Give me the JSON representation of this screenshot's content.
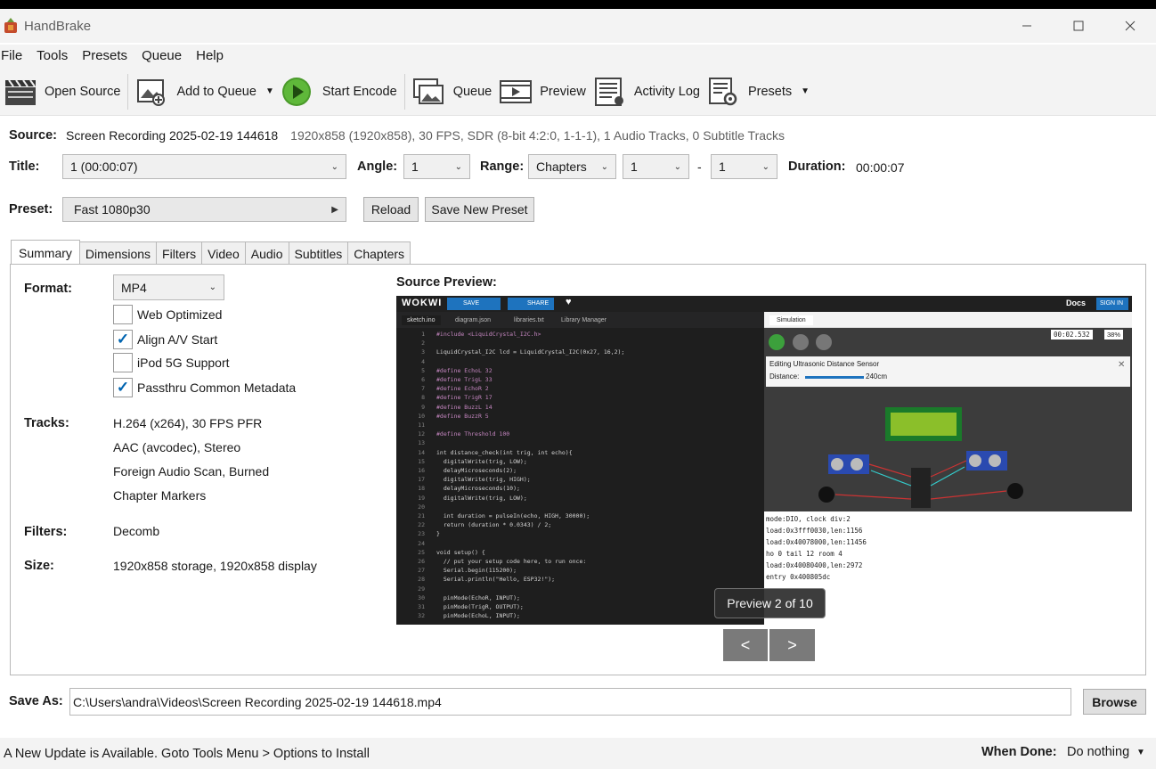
{
  "window": {
    "title": "HandBrake"
  },
  "menu": [
    "File",
    "Tools",
    "Presets",
    "Queue",
    "Help"
  ],
  "toolbar": {
    "open_source": "Open Source",
    "add_to_queue": "Add to Queue",
    "start_encode": "Start Encode",
    "queue": "Queue",
    "preview": "Preview",
    "activity_log": "Activity Log",
    "presets": "Presets"
  },
  "source": {
    "label": "Source:",
    "name": "Screen Recording 2025-02-19 144618",
    "info": "1920x858 (1920x858), 30 FPS, SDR (8-bit 4:2:0, 1-1-1), 1 Audio Tracks, 0 Subtitle Tracks"
  },
  "title_row": {
    "title_label": "Title:",
    "title_value": "1  (00:00:07)",
    "angle_label": "Angle:",
    "angle_value": "1",
    "range_label": "Range:",
    "range_value": "Chapters",
    "range_start": "1",
    "range_dash": "-",
    "range_end": "1",
    "duration_label": "Duration:",
    "duration_value": "00:00:07"
  },
  "preset": {
    "label": "Preset:",
    "value": "Fast 1080p30",
    "reload": "Reload",
    "save_new": "Save New Preset"
  },
  "tabs": [
    "Summary",
    "Dimensions",
    "Filters",
    "Video",
    "Audio",
    "Subtitles",
    "Chapters"
  ],
  "summary": {
    "format_label": "Format:",
    "format_value": "MP4",
    "options": [
      {
        "label": "Web Optimized",
        "checked": false
      },
      {
        "label": "Align A/V Start",
        "checked": true
      },
      {
        "label": "iPod 5G Support",
        "checked": false
      },
      {
        "label": "Passthru Common Metadata",
        "checked": true
      }
    ],
    "tracks_label": "Tracks:",
    "tracks": [
      "H.264 (x264), 30 FPS PFR",
      "AAC (avcodec), Stereo",
      "Foreign Audio Scan, Burned",
      "Chapter Markers"
    ],
    "filters_label": "Filters:",
    "filters_value": "Decomb",
    "size_label": "Size:",
    "size_value": "1920x858 storage, 1920x858 display"
  },
  "source_preview": {
    "label": "Source Preview:",
    "overlay": "Preview 2 of 10",
    "prev": "<",
    "next": ">",
    "wokwi": {
      "logo": "WOKWI",
      "save": "SAVE",
      "share": "SHARE",
      "docs": "Docs",
      "signin": "SIGN IN",
      "tabs": [
        "sketch.ino",
        "diagram.json",
        "libraries.txt",
        "Library Manager"
      ],
      "sim_tab": "Simulation",
      "timer": "00:02.532",
      "speed": "38%",
      "panel_title": "Editing Ultrasonic Distance Sensor",
      "distance_label": "Distance:",
      "distance_value": "240cm",
      "console": [
        "mode:DIO, clock div:2",
        "load:0x3fff0030,len:1156",
        "load:0x40078000,len:11456",
        "ho 0 tail 12 room 4",
        "load:0x40080400,len:2972",
        "entry 0x400805dc"
      ],
      "code": [
        "#include <LiquidCrystal_I2C.h>",
        "",
        "LiquidCrystal_I2C lcd = LiquidCrystal_I2C(0x27, 16,2);",
        "",
        "#define EchoL 32",
        "#define TrigL 33",
        "#define EchoR 2",
        "#define TrigR 17",
        "#define BuzzL 14",
        "#define BuzzR 5",
        "",
        "#define Threshold 100",
        "",
        "int distance_check(int trig, int echo){",
        "  digitalWrite(trig, LOW);",
        "  delayMicroseconds(2);",
        "  digitalWrite(trig, HIGH);",
        "  delayMicroseconds(10);",
        "  digitalWrite(trig, LOW);",
        "",
        "  int duration = pulseIn(echo, HIGH, 30000);",
        "  return (duration * 0.0343) / 2;",
        "}",
        "",
        "void setup() {",
        "  // put your setup code here, to run once:",
        "  Serial.begin(115200);",
        "  Serial.println(\"Hello, ESP32!\");",
        "",
        "  pinMode(EchoR, INPUT);",
        "  pinMode(TrigR, OUTPUT);",
        "  pinMode(EchoL, INPUT);"
      ]
    }
  },
  "save_as": {
    "label": "Save As:",
    "path": "C:\\Users\\andra\\Videos\\Screen Recording 2025-02-19 144618.mp4",
    "browse": "Browse"
  },
  "status": {
    "update_msg": "A New Update is Available. Goto Tools Menu > Options to Install",
    "when_done_label": "When Done:",
    "when_done_value": "Do nothing"
  }
}
